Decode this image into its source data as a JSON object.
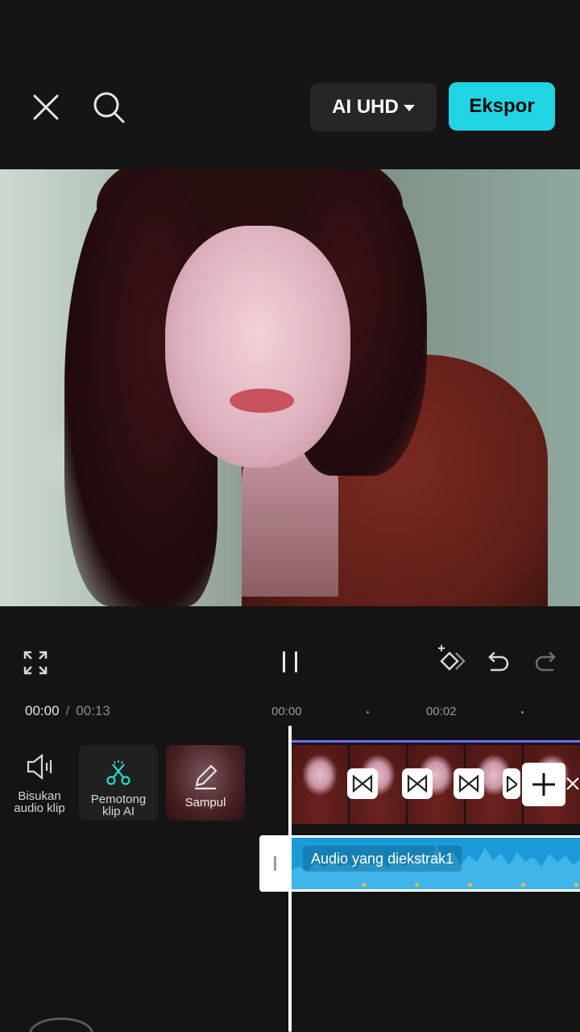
{
  "header": {
    "close_icon": "close-icon",
    "search_icon": "search-icon",
    "quality_label": "AI UHD",
    "export_label": "Ekspor",
    "accent_color": "#21d4e2"
  },
  "playback": {
    "current_time": "00:00",
    "separator": "/",
    "total_time": "00:13",
    "state": "playing"
  },
  "ruler": {
    "labels": [
      "00:00",
      "00:02"
    ]
  },
  "tools": {
    "mute_label_1": "Bisukan",
    "mute_label_2": "audio klip",
    "ai_cutter_label_1": "Pemotong",
    "ai_cutter_label_2": "klip AI",
    "cover_label": "Sampul"
  },
  "audio": {
    "label": "Audio yang diekstrak1",
    "color": "#1c9ad8"
  }
}
